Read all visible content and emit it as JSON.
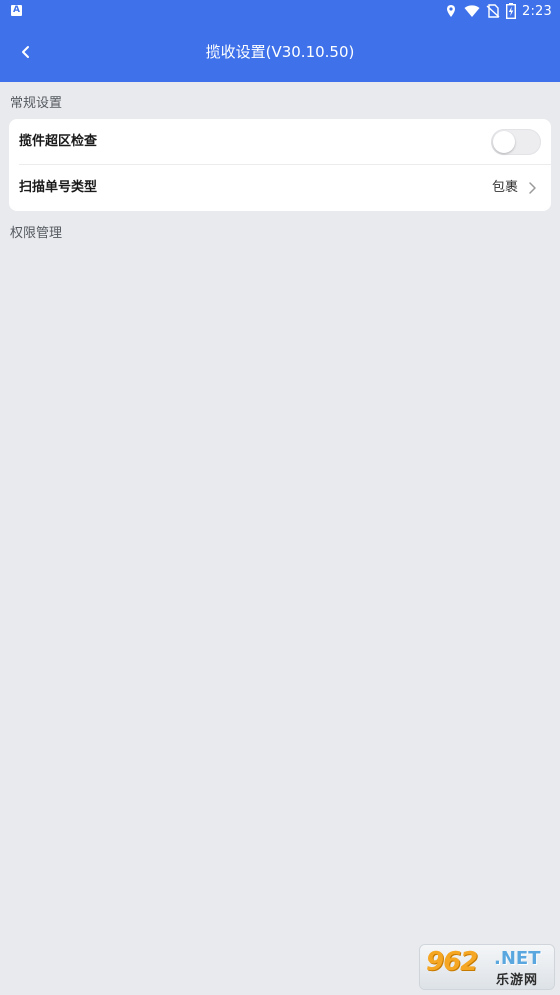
{
  "status_bar": {
    "app_icon_letter": "A",
    "time": "2:23",
    "icons": [
      "location-icon",
      "wifi-icon",
      "no-sim-icon",
      "battery-charging-icon"
    ]
  },
  "app_bar": {
    "title": "揽收设置(V30.10.50)",
    "back_icon": "back-arrow-icon",
    "background_color": "#3f72ea"
  },
  "sections": {
    "general": {
      "label": "常规设置",
      "rows": [
        {
          "label": "揽件超区检查",
          "control": "toggle",
          "on": false
        },
        {
          "label": "扫描单号类型",
          "value": "包裹",
          "control": "chevron-right-icon"
        }
      ]
    },
    "permissions": {
      "label": "权限管理"
    }
  },
  "watermark": {
    "number": "962",
    "net": ".NET",
    "cn": "乐游网"
  }
}
